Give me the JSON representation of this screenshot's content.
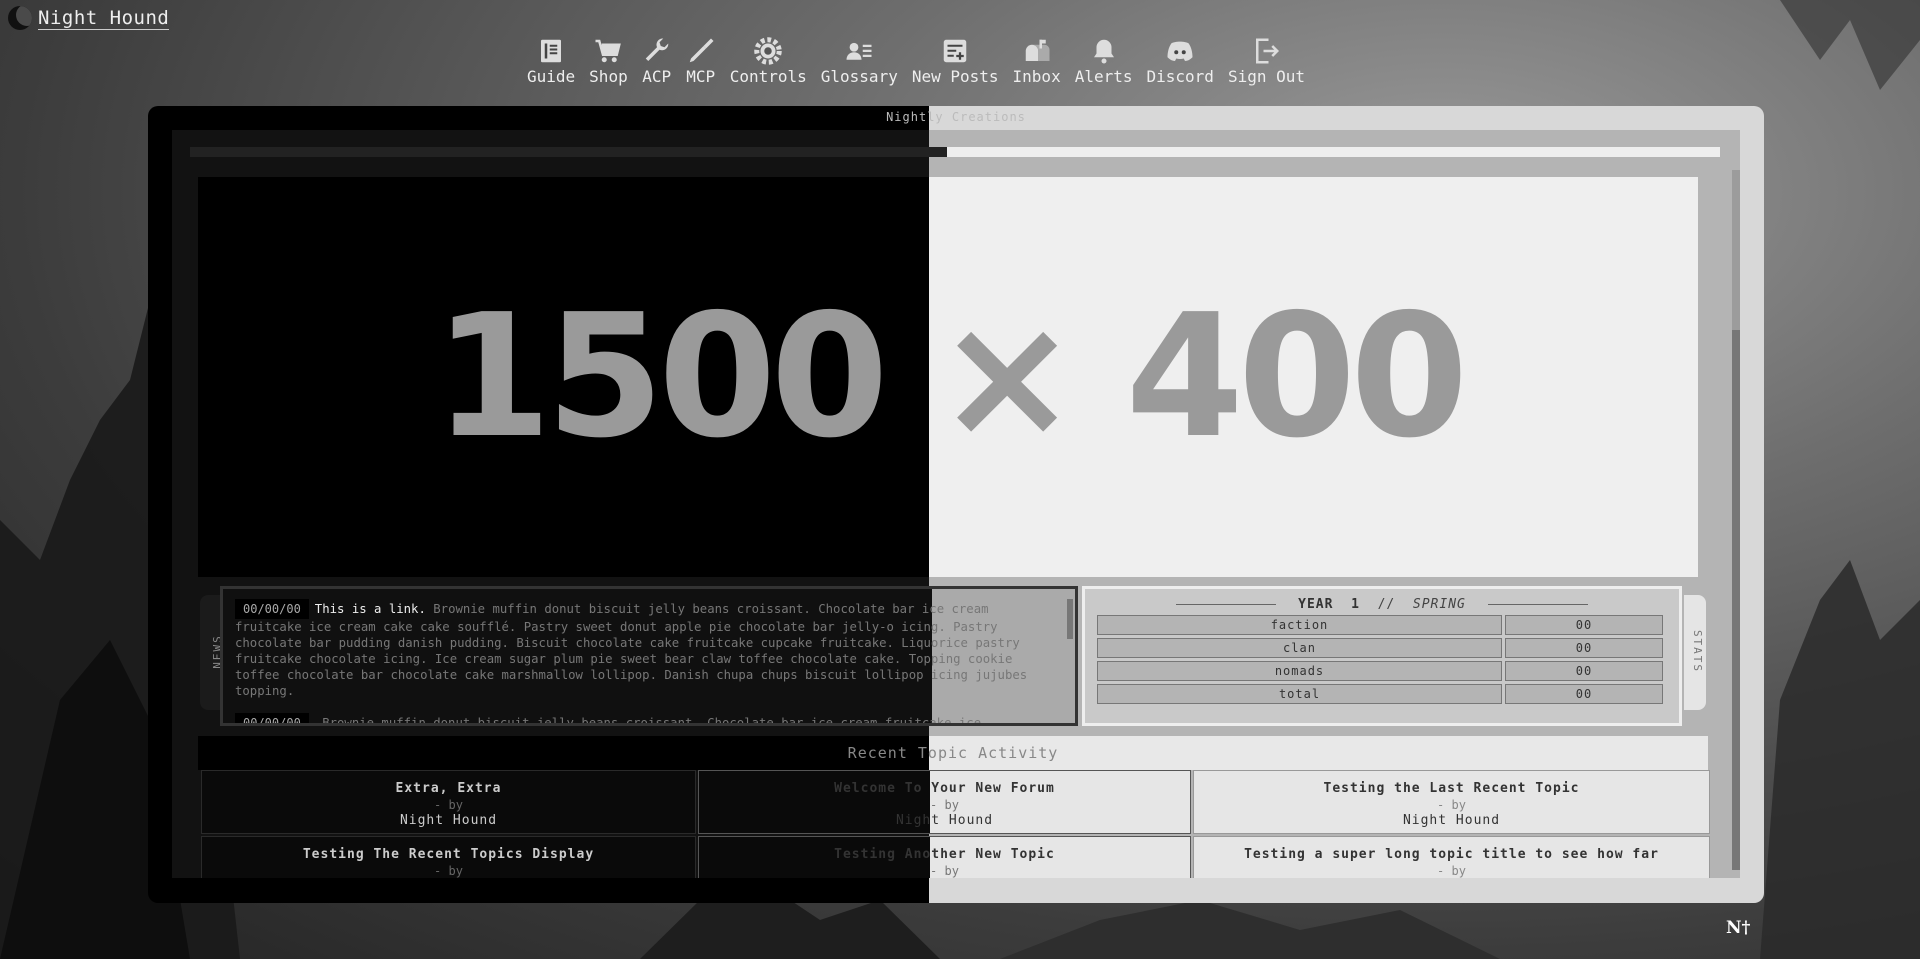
{
  "site": {
    "title": "Night Hound"
  },
  "nav": [
    {
      "label": "Guide",
      "icon": "book-icon"
    },
    {
      "label": "Shop",
      "icon": "cart-icon"
    },
    {
      "label": "ACP",
      "icon": "wrench-icon"
    },
    {
      "label": "MCP",
      "icon": "screwdriver-icon"
    },
    {
      "label": "Controls",
      "icon": "gear-icon"
    },
    {
      "label": "Glossary",
      "icon": "user-list-icon"
    },
    {
      "label": "New Posts",
      "icon": "new-post-icon"
    },
    {
      "label": "Inbox",
      "icon": "mailbox-icon"
    },
    {
      "label": "Alerts",
      "icon": "bell-icon"
    },
    {
      "label": "Discord",
      "icon": "discord-icon"
    },
    {
      "label": "Sign Out",
      "icon": "sign-out-icon"
    }
  ],
  "frame": {
    "title": "Nightly Creations"
  },
  "banner": {
    "text": "1500 × 400"
  },
  "news": {
    "tab_label": "NEWS",
    "entries": [
      {
        "date": "00/00/00",
        "link": "This is a link.",
        "text": "Brownie muffin donut biscuit jelly beans croissant. Chocolate bar ice cream fruitcake ice cream cake cake soufflé. Pastry sweet donut apple pie chocolate bar jelly-o icing. Pastry chocolate bar pudding danish pudding. Biscuit chocolate cake fruitcake cupcake fruitcake. Liquorice pastry fruitcake chocolate icing. Ice cream sugar plum pie sweet bear claw toffee chocolate cake. Topping cookie toffee chocolate bar chocolate cake marshmallow lollipop. Danish chupa chups biscuit lollipop icing jujubes topping."
      },
      {
        "date": "00/00/00",
        "link": "",
        "text": "Brownie muffin donut biscuit jelly beans croissant. Chocolate bar ice cream fruitcake ice"
      }
    ]
  },
  "stats": {
    "tab_label": "STATS",
    "year_label": "YEAR",
    "year": "1",
    "separator": "//",
    "season": "SPRING",
    "rows": [
      {
        "name": "faction",
        "value": "00"
      },
      {
        "name": "clan",
        "value": "00"
      },
      {
        "name": "nomads",
        "value": "00"
      },
      {
        "name": "total",
        "value": "00"
      }
    ]
  },
  "recent": {
    "heading": "Recent Topic Activity",
    "topics": [
      {
        "title": "Extra, Extra",
        "by": "- by",
        "author": "Night Hound"
      },
      {
        "title": "Welcome To Your New Forum",
        "by": "- by",
        "author": "Night Hound"
      },
      {
        "title": "Testing the Last Recent Topic",
        "by": "- by",
        "author": "Night Hound"
      },
      {
        "title": "Testing The Recent Topics Display",
        "by": "- by",
        "author": ""
      },
      {
        "title": "Testing Another New Topic",
        "by": "- by",
        "author": ""
      },
      {
        "title": "Testing a super long topic title to see how far",
        "by": "- by",
        "author": ""
      }
    ]
  },
  "footer": {
    "logo_text": "N†"
  }
}
